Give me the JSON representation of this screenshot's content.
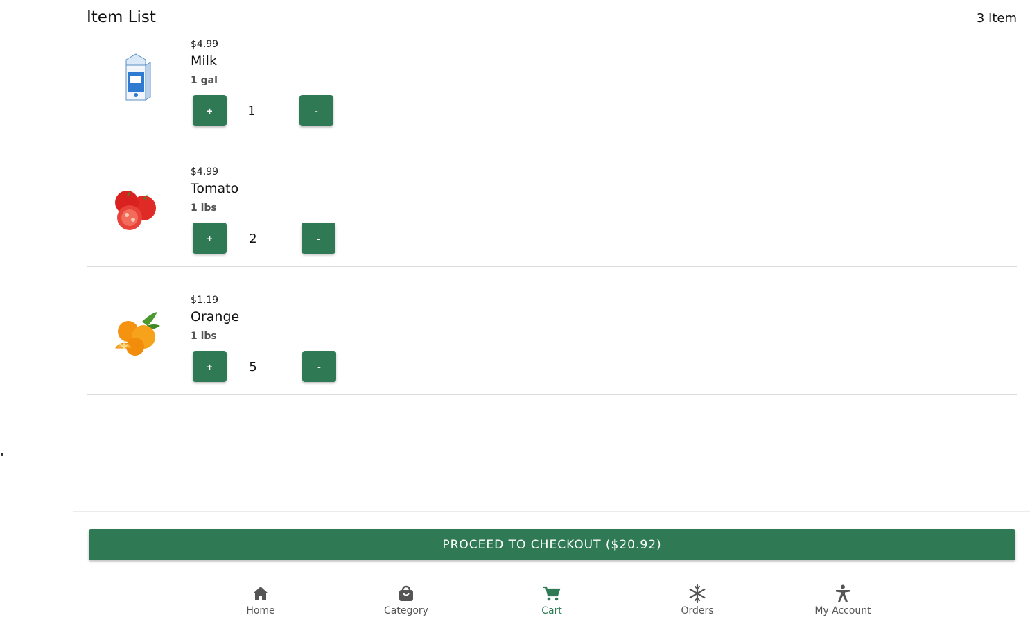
{
  "header": {
    "title": "Item List",
    "count_label": "3 Item"
  },
  "items": [
    {
      "price": "$4.99",
      "name": "Milk",
      "unit": "1 gal",
      "quantity": "1",
      "plus_label": "+",
      "minus_label": "-",
      "image": "milk-carton-image"
    },
    {
      "price": "$4.99",
      "name": "Tomato",
      "unit": "1 lbs",
      "quantity": "2",
      "plus_label": "+",
      "minus_label": "-",
      "image": "tomato-image"
    },
    {
      "price": "$1.19",
      "name": "Orange",
      "unit": "1 lbs",
      "quantity": "5",
      "plus_label": "+",
      "minus_label": "-",
      "image": "orange-image"
    }
  ],
  "checkout": {
    "label": "PROCEED TO CHECKOUT ($20.92)"
  },
  "nav": [
    {
      "label": "Home",
      "icon": "home-icon"
    },
    {
      "label": "Category",
      "icon": "shopping-bag-icon"
    },
    {
      "label": "Cart",
      "icon": "cart-icon",
      "active": true
    },
    {
      "label": "Orders",
      "icon": "snowflake-icon"
    },
    {
      "label": "My Account",
      "icon": "accessibility-icon"
    }
  ],
  "colors": {
    "accent": "#2f7a55",
    "nav_inactive": "#555555",
    "divider": "#dcdcdc"
  }
}
